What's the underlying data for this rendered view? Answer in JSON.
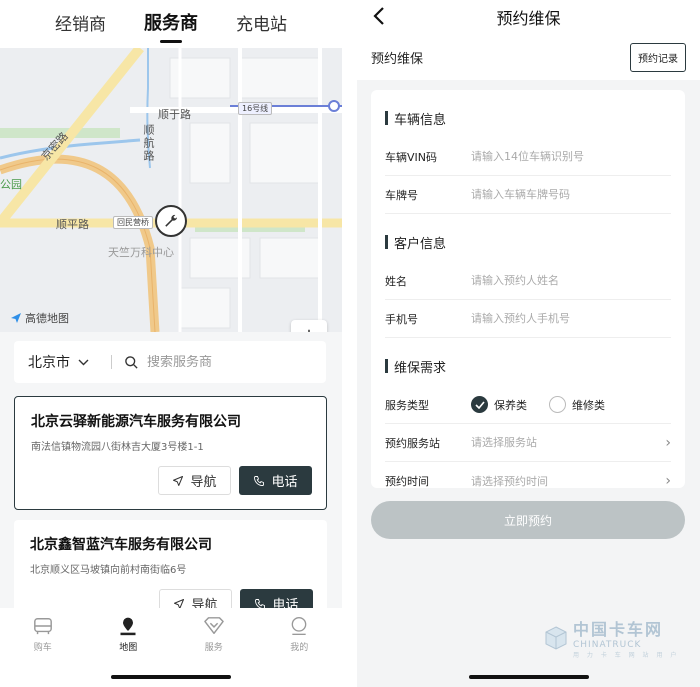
{
  "left": {
    "tabs": [
      {
        "label": "经销商"
      },
      {
        "label": "服务商",
        "active": true
      },
      {
        "label": "充电站"
      }
    ],
    "map": {
      "labels": {
        "shunyu_road": "顺于路",
        "shunhang_road": "顺航路",
        "shunping_road": "顺平路",
        "jingmi_road": "京密路",
        "park": "公园",
        "huimin_yingqiao": "回民营桥",
        "poi": "天竺万科中心",
        "road16": "16号线",
        "logo": "高德地图"
      }
    },
    "search": {
      "city": "北京市",
      "placeholder": "搜索服务商"
    },
    "cards": [
      {
        "name": "北京云驿新能源汽车服务有限公司",
        "address": "南法信镇物流园八街林吉大厦3号楼1-1",
        "nav_label": "导航",
        "call_label": "电话"
      },
      {
        "name": "北京鑫智蓝汽车服务有限公司",
        "address": "北京顺义区马坡镇向前村南街临6号",
        "nav_label": "导航",
        "call_label": "电话"
      }
    ],
    "bottom_nav": [
      {
        "label": "购车",
        "icon": "car-icon"
      },
      {
        "label": "地图",
        "icon": "map-pin-icon",
        "active": true
      },
      {
        "label": "服务",
        "icon": "service-icon"
      },
      {
        "label": "我的",
        "icon": "user-icon"
      }
    ]
  },
  "right": {
    "header_title": "预约维保",
    "subtitle": "预约维保",
    "history_button": "预约记录",
    "sections": {
      "vehicle": {
        "title": "车辆信息",
        "vin_label": "车辆VIN码",
        "vin_placeholder": "请输入14位车辆识别号",
        "plate_label": "车牌号",
        "plate_placeholder": "请输入车辆车牌号码"
      },
      "customer": {
        "title": "客户信息",
        "name_label": "姓名",
        "name_placeholder": "请输入预约人姓名",
        "phone_label": "手机号",
        "phone_placeholder": "请输入预约人手机号"
      },
      "requirement": {
        "title": "维保需求",
        "type_label": "服务类型",
        "option_maintenance": "保养类",
        "option_repair": "维修类",
        "station_label": "预约服务站",
        "station_placeholder": "请选择服务站",
        "time_label": "预约时间",
        "time_placeholder": "请选择预约时间"
      }
    },
    "submit": "立即预约",
    "watermark": {
      "cn": "中国卡车网",
      "en": "CHINATRUCK",
      "sub": "用 力 卡 车 网 站 用 户"
    },
    "colors": {
      "accent": "#2b3a3f",
      "submit_disabled": "#bcc3c5"
    }
  }
}
